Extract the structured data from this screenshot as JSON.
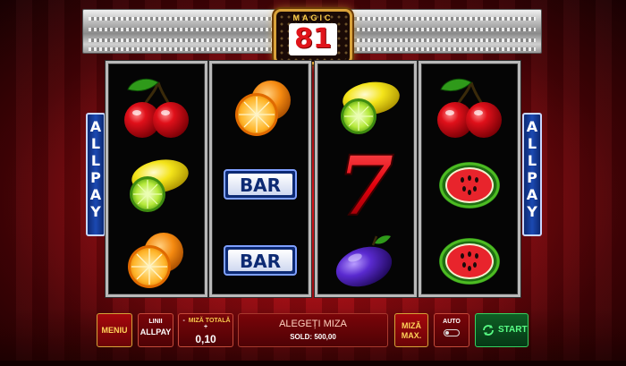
{
  "logo": {
    "top_text": "MAGIC",
    "number": "81"
  },
  "side_label": {
    "text": "ALLPAY"
  },
  "reels": [
    [
      "cherry",
      "lemon",
      "orange"
    ],
    [
      "orange",
      "bar",
      "bar"
    ],
    [
      "lemon",
      "seven",
      "plum"
    ],
    [
      "cherry",
      "watermelon",
      "watermelon"
    ]
  ],
  "symbols": {
    "bar_text": "BAR",
    "seven_text": "7"
  },
  "controls": {
    "menu_label": "MENIU",
    "lines_label": "LINII",
    "lines_value": "ALLPAY",
    "stake_label": "MIZĂ TOTALĂ",
    "stake_value": "0,10",
    "minus": "-",
    "plus": "+",
    "message": "ALEGEȚI MIZA",
    "balance": "SOLD: 500,00",
    "max_bet_line1": "MIZĂ",
    "max_bet_line2": "MAX.",
    "auto_label": "AUTO",
    "start_label": "START"
  },
  "colors": {
    "accent_gold": "#ffd35a",
    "start_green": "#35d35f",
    "button_red": "#a5070c"
  }
}
